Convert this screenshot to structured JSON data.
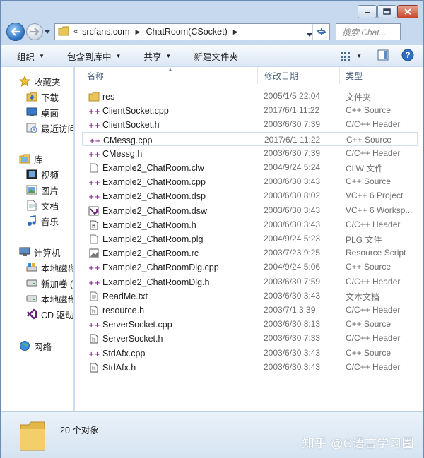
{
  "address": {
    "separator": "«",
    "crumbs": [
      "srcfans.com",
      "ChatRoom(CSocket)"
    ]
  },
  "search": {
    "placeholder": "搜索 Chat..."
  },
  "toolbar": {
    "organize": "组织",
    "include_in_library": "包含到库中",
    "share": "共享",
    "new_folder": "新建文件夹"
  },
  "navpane": {
    "favorites": "收藏夹",
    "downloads": "下载",
    "desktop": "桌面",
    "recent": "最近访问",
    "libraries": "库",
    "videos": "视频",
    "pictures": "图片",
    "documents": "文档",
    "music": "音乐",
    "computer": "计算机",
    "local_disk_1": "本地磁盘",
    "new_volume": "新加卷 (D",
    "local_disk_2": "本地磁盘",
    "cd_drive": "CD 驱动器",
    "network": "网络"
  },
  "columns": {
    "name": "名称",
    "date": "修改日期",
    "type": "类型"
  },
  "files": [
    {
      "name": "res",
      "date": "2005/1/5 22:04",
      "type": "文件夹",
      "icon": "folder-icon"
    },
    {
      "name": "ClientSocket.cpp",
      "date": "2017/6/1 11:22",
      "type": "C++ Source",
      "icon": "cpp-file-icon"
    },
    {
      "name": "ClientSocket.h",
      "date": "2003/6/30 7:39",
      "type": "C/C++ Header",
      "icon": "cpp-file-icon"
    },
    {
      "name": "CMessg.cpp",
      "date": "2017/6/1 11:22",
      "type": "C++ Source",
      "icon": "cpp-file-icon",
      "selected": true
    },
    {
      "name": "CMessg.h",
      "date": "2003/6/30 7:39",
      "type": "C/C++ Header",
      "icon": "cpp-file-icon"
    },
    {
      "name": "Example2_ChatRoom.clw",
      "date": "2004/9/24 5:24",
      "type": "CLW 文件",
      "icon": "blank-file-icon"
    },
    {
      "name": "Example2_ChatRoom.cpp",
      "date": "2003/6/30 3:43",
      "type": "C++ Source",
      "icon": "cpp-file-icon"
    },
    {
      "name": "Example2_ChatRoom.dsp",
      "date": "2003/6/30 8:02",
      "type": "VC++ 6 Project",
      "icon": "cpp-file-icon"
    },
    {
      "name": "Example2_ChatRoom.dsw",
      "date": "2003/6/30 3:43",
      "type": "VC++ 6 Worksp...",
      "icon": "vs-file-icon"
    },
    {
      "name": "Example2_ChatRoom.h",
      "date": "2003/6/30 3:43",
      "type": "C/C++ Header",
      "icon": "header-file-icon"
    },
    {
      "name": "Example2_ChatRoom.plg",
      "date": "2004/9/24 5:23",
      "type": "PLG 文件",
      "icon": "blank-file-icon"
    },
    {
      "name": "Example2_ChatRoom.rc",
      "date": "2003/7/23 9:25",
      "type": "Resource Script",
      "icon": "image-file-icon"
    },
    {
      "name": "Example2_ChatRoomDlg.cpp",
      "date": "2004/9/24 5:06",
      "type": "C++ Source",
      "icon": "cpp-file-icon"
    },
    {
      "name": "Example2_ChatRoomDlg.h",
      "date": "2003/6/30 7:59",
      "type": "C/C++ Header",
      "icon": "cpp-file-icon"
    },
    {
      "name": "ReadMe.txt",
      "date": "2003/6/30 3:43",
      "type": "文本文档",
      "icon": "text-file-icon"
    },
    {
      "name": "resource.h",
      "date": "2003/7/1 3:39",
      "type": "C/C++ Header",
      "icon": "header-file-icon"
    },
    {
      "name": "ServerSocket.cpp",
      "date": "2003/6/30 8:13",
      "type": "C++ Source",
      "icon": "cpp-file-icon"
    },
    {
      "name": "ServerSocket.h",
      "date": "2003/6/30 7:33",
      "type": "C/C++ Header",
      "icon": "header-file-icon"
    },
    {
      "name": "StdAfx.cpp",
      "date": "2003/6/30 3:43",
      "type": "C++ Source",
      "icon": "cpp-file-icon"
    },
    {
      "name": "StdAfx.h",
      "date": "2003/6/30 3:43",
      "type": "C/C++ Header",
      "icon": "header-file-icon"
    }
  ],
  "status": {
    "count_text": "20 个对象"
  },
  "watermark": "知乎 @C语言学习圈"
}
